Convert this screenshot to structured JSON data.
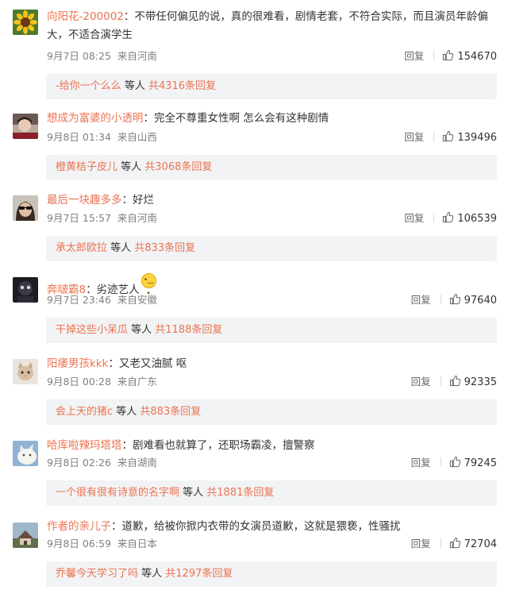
{
  "comments": [
    {
      "username": "向阳花-200002",
      "sep": "：",
      "text": "不带任何偏见的说，真的很难看，剧情老套，不符合实际，而且演员年龄偏大，不适合演学生",
      "date": "9月7日 08:25",
      "location": "来自河南",
      "reply_label": "回复",
      "likes": "154670",
      "reply_user": "-给你一个么么",
      "reply_mid": " 等人 ",
      "reply_count": "共4316条回复",
      "avatar_icon": "sunflower-avatar"
    },
    {
      "username": "想成为富婆的小透明",
      "sep": "：",
      "text": "完全不尊重女性啊 怎么会有这种剧情",
      "date": "9月8日 01:34",
      "location": "来自山西",
      "reply_label": "回复",
      "likes": "139496",
      "reply_user": "橙黄桔子皮儿",
      "reply_mid": " 等人 ",
      "reply_count": "共3068条回复",
      "avatar_icon": "person-avatar"
    },
    {
      "username": "最后一块趣多多",
      "sep": "：",
      "text": "好烂",
      "date": "9月7日 15:57",
      "location": "来自河南",
      "reply_label": "回复",
      "likes": "106539",
      "reply_user": "承太郎欧拉",
      "reply_mid": " 等人 ",
      "reply_count": "共833条回复",
      "avatar_icon": "sunglasses-avatar"
    },
    {
      "username": "奔啵霸8",
      "sep": "：",
      "text": "劣迹艺人",
      "emoji": "shush-face",
      "date": "9月7日 23:46",
      "location": "来自安徽",
      "reply_label": "回复",
      "likes": "97640",
      "reply_user": "干掉这些小呆瓜",
      "reply_mid": " 等人 ",
      "reply_count": "共1188条回复",
      "avatar_icon": "dark-character-avatar"
    },
    {
      "username": "阳痿男孩kkk",
      "sep": "：",
      "text": "又老又油腻 呕",
      "date": "9月8日 00:28",
      "location": "来自广东",
      "reply_label": "回复",
      "likes": "92335",
      "reply_user": "会上天的猪c",
      "reply_mid": " 等人 ",
      "reply_count": "共883条回复",
      "avatar_icon": "cat-avatar"
    },
    {
      "username": "哈库啦辣玛塔塔",
      "sep": "：",
      "text": "剧难看也就算了，还职场霸凌，擅警察",
      "date": "9月8日 02:26",
      "location": "来自湖南",
      "reply_label": "回复",
      "likes": "79245",
      "reply_user": "一个很有很有诗意的名字啊",
      "reply_mid": " 等人 ",
      "reply_count": "共1881条回复",
      "avatar_icon": "white-cat-avatar"
    },
    {
      "username": "作者的亲儿子",
      "sep": "：",
      "text": "道歉，给被你掀内衣带的女演员道歉，这就是猥亵，性骚扰",
      "date": "9月8日 06:59",
      "location": "来自日本",
      "reply_label": "回复",
      "likes": "72704",
      "reply_user": "乔馨今天学习了吗",
      "reply_mid": " 等人 ",
      "reply_count": "共1297条回复",
      "avatar_icon": "house-photo-avatar"
    }
  ]
}
